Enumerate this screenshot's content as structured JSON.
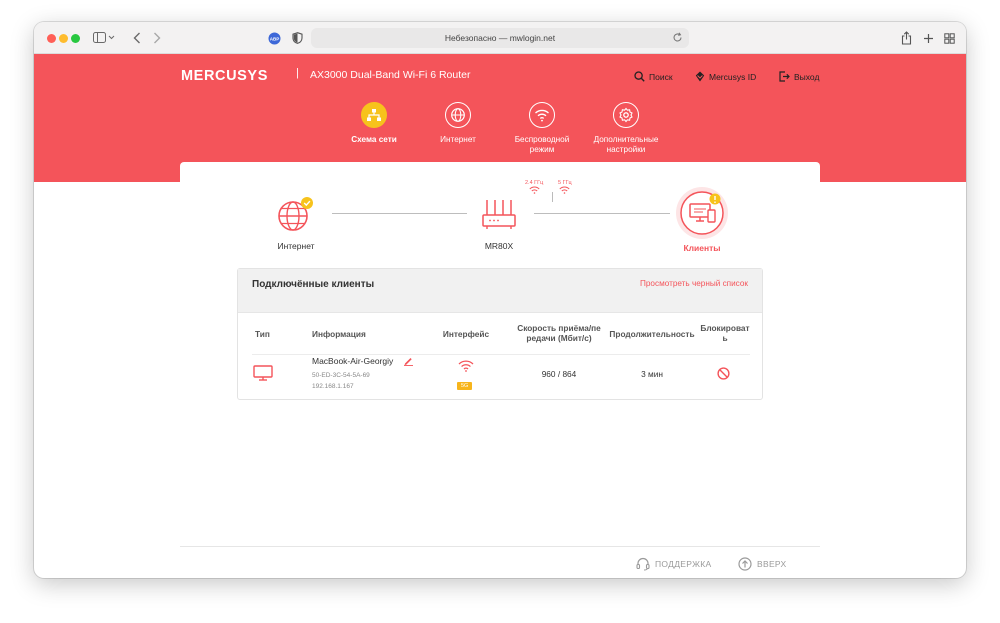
{
  "browser": {
    "address": "Небезопасно — mwlogin.net",
    "extension_badge": "ABP"
  },
  "header": {
    "brand": "MERCUSYS",
    "separator": "|",
    "model": "AX3000 Dual-Band Wi-Fi 6 Router",
    "search_label": "Поиск",
    "account_label": "Mercusys ID",
    "logout_label": "Выход"
  },
  "nav": [
    {
      "label": "Схема сети",
      "icon": "network-map-icon",
      "active": true
    },
    {
      "label": "Интернет",
      "icon": "globe-icon",
      "active": false
    },
    {
      "label": "Беспроводной\nрежим",
      "icon": "wifi-icon",
      "active": false
    },
    {
      "label": "Дополнительные\nнастройки",
      "icon": "gear-icon",
      "active": false
    }
  ],
  "topology": {
    "internet_label": "Интернет",
    "router_label": "MR80X",
    "band_24": "2.4 ГГц",
    "band_5": "5 ГГц",
    "clients_label": "Клиенты"
  },
  "clients_panel": {
    "title": "Подключённые клиенты",
    "blacklist_link": "Просмотреть черный список",
    "columns": {
      "type": "Тип",
      "info": "Информация",
      "interface": "Интерфейс",
      "speed": "Скорость приёма/пе\nредачи (Мбит/с)",
      "duration": "Продолжительность",
      "block": "Блокироват\nь"
    },
    "rows": [
      {
        "name": "MacBook-Air-Georgiy",
        "mac": "50-ED-3C-54-5A-69",
        "ip": "192.168.1.167",
        "band_badge": "5G",
        "speed": "960 / 864",
        "duration": "3 мин"
      }
    ]
  },
  "footer": {
    "support_label": "ПОДДЕРЖКА",
    "top_label": "ВВЕРХ"
  },
  "colors": {
    "brand_red": "#f4545a",
    "active_yellow": "#f7c31c",
    "badge_orange": "#f7b51c"
  }
}
